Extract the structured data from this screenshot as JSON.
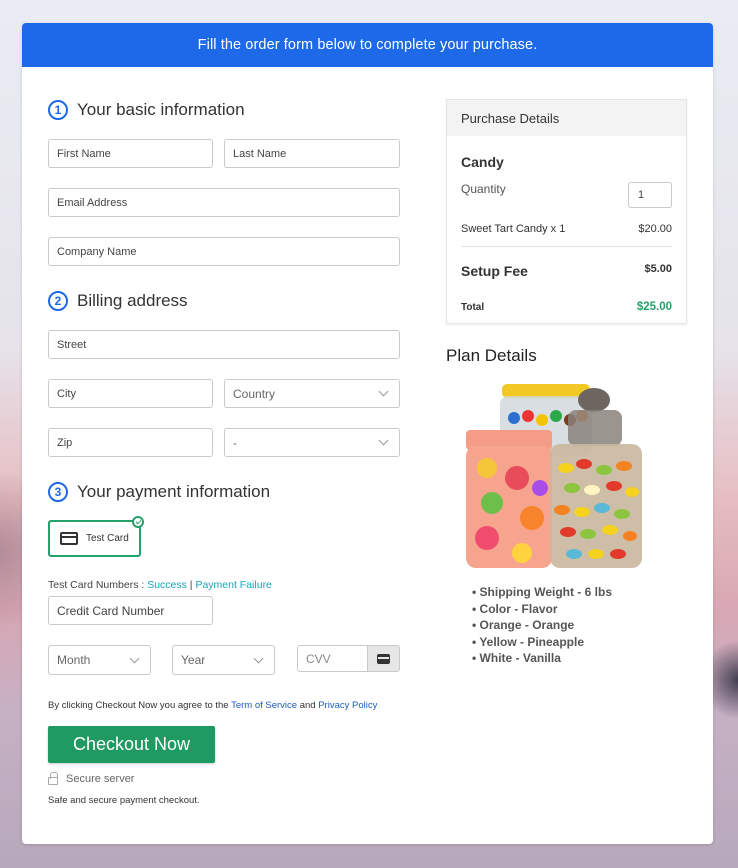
{
  "banner": {
    "text": "Fill the order form below to complete your purchase."
  },
  "sections": {
    "basic": {
      "number": "1",
      "title": "Your basic information"
    },
    "billing": {
      "number": "2",
      "title": "Billing address"
    },
    "payment": {
      "number": "3",
      "title": "Your payment information"
    }
  },
  "fields": {
    "first_name": {
      "placeholder": "First Name",
      "value": ""
    },
    "last_name": {
      "placeholder": "Last Name",
      "value": ""
    },
    "email": {
      "placeholder": "Email Address",
      "value": ""
    },
    "company": {
      "placeholder": "Company Name",
      "value": ""
    },
    "street": {
      "placeholder": "Street",
      "value": ""
    },
    "city": {
      "placeholder": "City",
      "value": ""
    },
    "country": {
      "selected": "Country"
    },
    "zip": {
      "placeholder": "Zip",
      "value": ""
    },
    "state": {
      "selected": "-"
    },
    "card_number": {
      "placeholder": "Credit Card Number",
      "value": ""
    },
    "month": {
      "selected": "Month"
    },
    "year": {
      "selected": "Year"
    },
    "cvv": {
      "placeholder": "CVV",
      "value": ""
    }
  },
  "payment": {
    "method_label": "Test Card",
    "method_selected": true,
    "test_cards_label": "Test Card Numbers : ",
    "success_link": "Success",
    "separator": " | ",
    "failure_link": "Payment Failure"
  },
  "agreement": {
    "prefix": "By clicking Checkout Now you agree to the ",
    "terms_link": "Term of Service",
    "middle": " and ",
    "privacy_link": "Privacy Policy"
  },
  "checkout": {
    "button_label": "Checkout Now",
    "secure_label": "Secure server",
    "safe_text": "Safe and secure payment checkout."
  },
  "purchase_details": {
    "title": "Purchase Details",
    "product": "Candy",
    "quantity_label": "Quantity",
    "quantity_value": "1",
    "line_item": "Sweet Tart Candy x 1",
    "line_price": "$20.00",
    "setup_fee_label": "Setup Fee",
    "setup_fee_value": "$5.00",
    "total_label": "Total",
    "total_value": "$25.00"
  },
  "plan_details": {
    "title": "Plan Details",
    "image_alt": "Candy jars",
    "items": [
      "Shipping Weight - 6 lbs",
      "Color - Flavor",
      "Orange - Orange",
      "Yellow - Pineapple",
      "White - Vanilla"
    ]
  },
  "colors": {
    "banner_blue": "#1e69e8",
    "checkout_green": "#1f9a62",
    "total_green": "#26a06a",
    "link_teal": "#1aa3b8",
    "link_blue": "#1e5bbf"
  }
}
